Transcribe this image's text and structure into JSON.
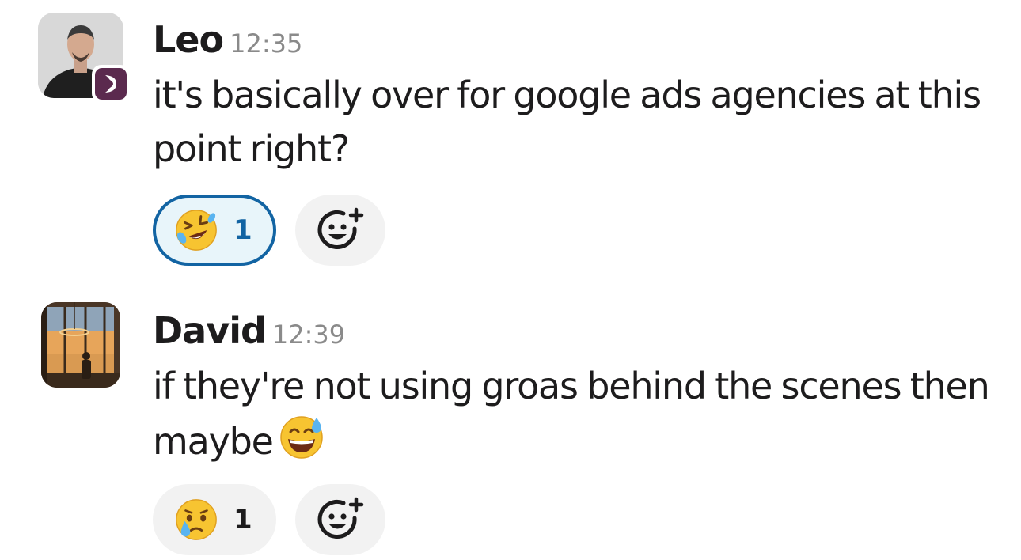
{
  "messages": [
    {
      "sender": "Leo",
      "time": "12:35",
      "text": "it's basically over for google ads agencies at this point right?",
      "avatar": "user-photo",
      "badge_icon": "app-badge-icon",
      "reactions": [
        {
          "emoji": "rolling-on-the-floor-laughing",
          "count": "1",
          "reacted_by_me": true
        }
      ],
      "add_reaction_icon": "add-reaction-icon"
    },
    {
      "sender": "David",
      "time": "12:39",
      "text": "if they're not using groas behind the scenes then maybe",
      "inline_emoji": "grinning-face-with-sweat",
      "avatar": "user-photo",
      "reactions": [
        {
          "emoji": "face-holding-back-tears",
          "count": "1",
          "reacted_by_me": false
        }
      ],
      "add_reaction_icon": "add-reaction-icon"
    }
  ],
  "colors": {
    "text": "#1d1c1d",
    "timestamp": "#8a8a8a",
    "reaction_active_border": "#1264a3",
    "reaction_active_bg": "#e8f5fa",
    "reaction_bg": "#f2f2f2",
    "badge": "#5b2a4e"
  }
}
